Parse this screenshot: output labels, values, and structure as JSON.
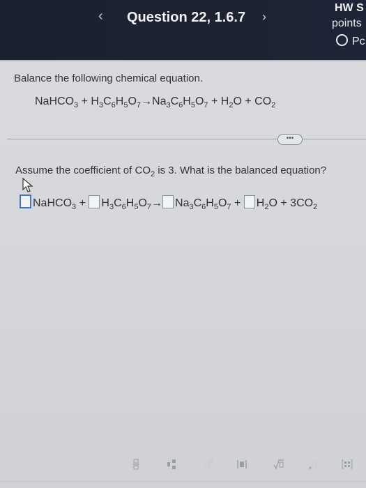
{
  "header": {
    "title": "Question 22, 1.6.7",
    "prev": "‹",
    "next": "›",
    "hw_label": "HW S",
    "points_label": "points",
    "pc_label": "Pc"
  },
  "question": {
    "instruction": "Balance the following chemical equation.",
    "equation": {
      "reactant1": "NaHCO",
      "r1_sub": "3",
      "plus1": " + ",
      "reactant2_a": "H",
      "r2_sub1": "3",
      "reactant2_b": "C",
      "r2_sub2": "6",
      "reactant2_c": "H",
      "r2_sub3": "5",
      "reactant2_d": "O",
      "r2_sub4": "7",
      "arrow": "→",
      "product1_a": "Na",
      "p1_sub1": "3",
      "product1_b": "C",
      "p1_sub2": "6",
      "product1_c": "H",
      "p1_sub3": "5",
      "product1_d": "O",
      "p1_sub4": "7",
      "plus2": " + ",
      "product2_a": "H",
      "p2_sub": "2",
      "product2_b": "O",
      "plus3": " + ",
      "product3": "CO",
      "p3_sub": "2"
    },
    "more_button": "•••",
    "part_prompt_a": "Assume the coefficient of CO",
    "part_prompt_sub": "2",
    "part_prompt_b": " is 3. What is the balanced equation?",
    "answer": {
      "reactant1": "NaHCO",
      "r1_sub": "3",
      "plus1": " + ",
      "reactant2_a": "H",
      "r2_sub1": "3",
      "reactant2_b": "C",
      "r2_sub2": "6",
      "reactant2_c": "H",
      "r2_sub3": "5",
      "reactant2_d": "O",
      "r2_sub4": "7",
      "arrow": "→",
      "product1_a": "Na",
      "p1_sub1": "3",
      "product1_b": "C",
      "p1_sub2": "6",
      "product1_c": "H",
      "p1_sub3": "5",
      "product1_d": "O",
      "p1_sub4": "7",
      "plus2": " + ",
      "product2_a": "H",
      "p2_sub": "2",
      "product2_b": "O",
      "plus3": " + ",
      "product3_coef": "3",
      "product3": "CO",
      "p3_sub": "2"
    }
  },
  "toolbar": {
    "icons": [
      "fraction-icon",
      "mixed-number-icon",
      "exponent-icon",
      "absolute-value-icon",
      "square-root-icon",
      "decimal-icon",
      "matrix-icon"
    ]
  }
}
